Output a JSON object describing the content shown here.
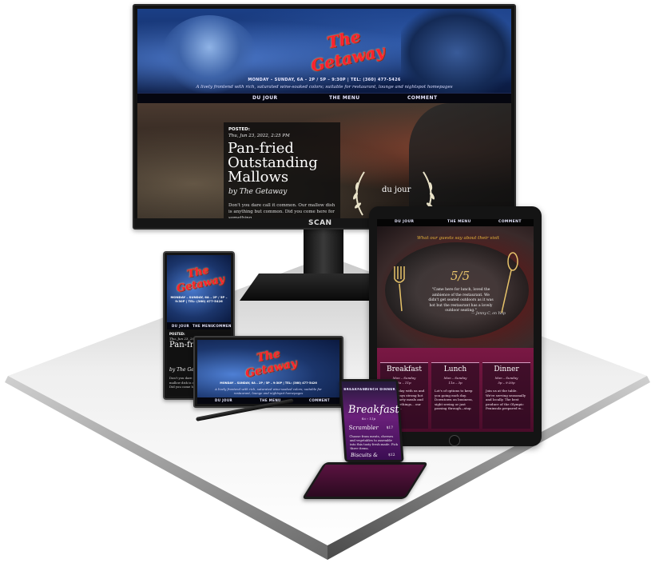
{
  "brand": {
    "logo": "The Getaway",
    "monitor_brand": "SCAN"
  },
  "site": {
    "hours": "MONDAY – SUNDAY, 6A – 2P / 5P – 9:30P | TEL: (360) 477-5426",
    "tagline": "A lively frontend with rich, saturated wine-soaked colors; suitable for restaurant, lounge and nightspot homepages",
    "nav": [
      "DU JOUR",
      "THE MENU",
      "COMMENT"
    ]
  },
  "post": {
    "posted_label": "POSTED:",
    "date": "Thu, Jun 23, 2022, 2:25 PM",
    "title": "Pan-fried Outstanding Mallows",
    "byline": "by The Getaway",
    "excerpt": "Don't you dare call it common. Our mallow dish is anything but common. Did you come here for something"
  },
  "du_jour": {
    "label": "du jour"
  },
  "review": {
    "greeting": "What our guests say about their visit",
    "score": "5/5",
    "quote": "\"Came here for lunch, loved the ambience of the restaurant. We didn't get seated outdoors as it was hot but the restaurant has a lovely outdoor seating.\"",
    "author": "— Jenny C, on Yelp"
  },
  "meals": [
    {
      "name": "Breakfast",
      "days": "Mon – Sunday",
      "hours": "6a – 11p",
      "desc": "Start the day with us and enjoy. Always strong hot coffee, hearty meals and fresh somethings... our signature..."
    },
    {
      "name": "Lunch",
      "days": "Mon – Sunday",
      "hours": "11a – 3p",
      "desc": "Lot's of options to keep you going each day. Downtown on business, sight seeing or just passing through—stop"
    },
    {
      "name": "Dinner",
      "days": "Mon – Sunday",
      "hours": "5p – 9:30p",
      "desc": "Join us at the table. We're serving seasonally and locally. The best produce of the Olympic Peninsula prepared w..."
    }
  ],
  "flip": {
    "nav": [
      "BREAKFAST",
      "LUNCH",
      "DINNER"
    ],
    "section": "Breakfast",
    "hours": "6a – 11p",
    "dish1": "Scrambler",
    "price1": "$17",
    "dish1_desc": "Choose from meats, cheeses and vegetables to assemble into this tasty fresh-made. Pick three items.",
    "dish2": "Biscuits &",
    "price2": "$12"
  },
  "colors": {
    "accent_red": "#ff2030",
    "gold": "#e7c36a",
    "wine": "#7a1844",
    "night_blue": "#1b3f86"
  }
}
